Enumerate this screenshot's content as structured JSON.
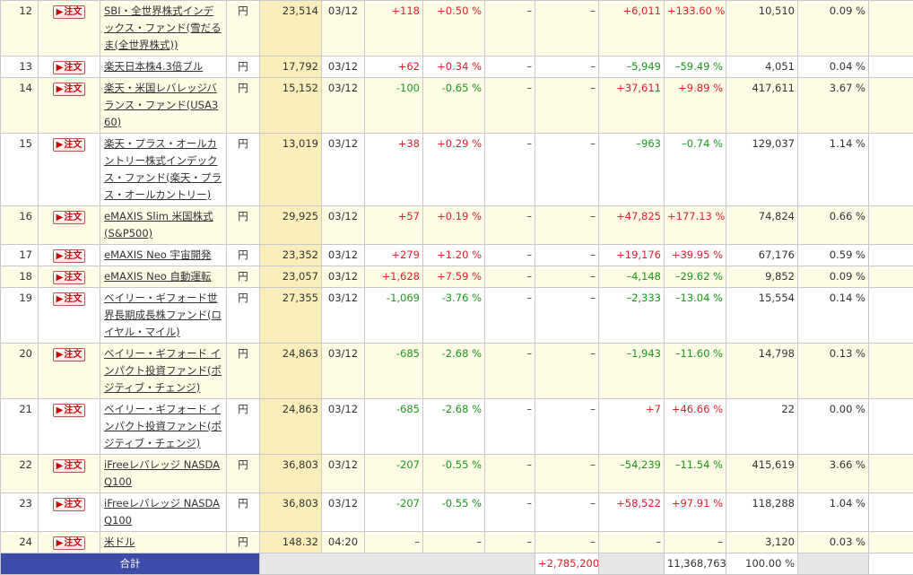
{
  "order_button_label": "注文",
  "rows": [
    {
      "no": "12",
      "name": "SBI・全世界株式インデックス・ファンド(雪だるま(全世界株式))",
      "cur": "円",
      "price": "23,514",
      "date": "03/12",
      "chg": "+118",
      "chgp": "+0.50 %",
      "a": "–",
      "b": "–",
      "pl": "+6,011",
      "plp": "+133.60 %",
      "val": "10,510",
      "pct": "0.09 %",
      "z": "–",
      "bg": "y",
      "h": 60
    },
    {
      "no": "13",
      "name": "楽天日本株4.3倍ブル",
      "cur": "円",
      "price": "17,792",
      "date": "03/12",
      "chg": "+62",
      "chgp": "+0.34 %",
      "a": "–",
      "b": "–",
      "pl": "–5,949",
      "plp": "–59.49 %",
      "val": "4,051",
      "pct": "0.04 %",
      "z": "–",
      "bg": "w",
      "h": 22
    },
    {
      "no": "14",
      "name": "楽天・米国レバレッジバランス・ファンド(USA360)",
      "cur": "円",
      "price": "15,152",
      "date": "03/12",
      "chg": "-100",
      "chgp": "-0.65 %",
      "a": "–",
      "b": "–",
      "pl": "+37,611",
      "plp": "+9.89 %",
      "val": "417,611",
      "pct": "3.67 %",
      "z": "–",
      "bg": "y",
      "h": 60
    },
    {
      "no": "15",
      "name": "楽天・プラス・オールカントリー株式インデックス・ファンド(楽天・プラス・オールカントリー)",
      "cur": "円",
      "price": "13,019",
      "date": "03/12",
      "chg": "+38",
      "chgp": "+0.29 %",
      "a": "–",
      "b": "–",
      "pl": "–963",
      "plp": "–0.74 %",
      "val": "129,037",
      "pct": "1.14 %",
      "z": "–",
      "bg": "w",
      "h": 80
    },
    {
      "no": "16",
      "name": "eMAXIS Slim 米国株式(S&P500)",
      "cur": "円",
      "price": "29,925",
      "date": "03/12",
      "chg": "+57",
      "chgp": "+0.19 %",
      "a": "–",
      "b": "–",
      "pl": "+47,825",
      "plp": "+177.13 %",
      "val": "74,824",
      "pct": "0.66 %",
      "z": "–",
      "bg": "y",
      "h": 40
    },
    {
      "no": "17",
      "name": "eMAXIS Neo 宇宙開発",
      "cur": "円",
      "price": "23,352",
      "date": "03/12",
      "chg": "+279",
      "chgp": "+1.20 %",
      "a": "–",
      "b": "–",
      "pl": "+19,176",
      "plp": "+39.95 %",
      "val": "67,176",
      "pct": "0.59 %",
      "z": "–",
      "bg": "w",
      "h": 22
    },
    {
      "no": "18",
      "name": "eMAXIS Neo 自動運転",
      "cur": "円",
      "price": "23,057",
      "date": "03/12",
      "chg": "+1,628",
      "chgp": "+7.59 %",
      "a": "–",
      "b": "–",
      "pl": "–4,148",
      "plp": "–29.62 %",
      "val": "9,852",
      "pct": "0.09 %",
      "z": "–",
      "bg": "y",
      "h": 22
    },
    {
      "no": "19",
      "name": "ベイリー・ギフォード世界長期成長株ファンド(ロイヤル・マイル)",
      "cur": "円",
      "price": "27,355",
      "date": "03/12",
      "chg": "-1,069",
      "chgp": "-3.76 %",
      "a": "–",
      "b": "–",
      "pl": "–2,333",
      "plp": "–13.04 %",
      "val": "15,554",
      "pct": "0.14 %",
      "z": "–",
      "bg": "w",
      "h": 60
    },
    {
      "no": "20",
      "name": "ベイリー・ギフォード インパクト投資ファンド(ポジティブ・チェンジ)",
      "cur": "円",
      "price": "24,863",
      "date": "03/12",
      "chg": "-685",
      "chgp": "-2.68 %",
      "a": "–",
      "b": "–",
      "pl": "–1,943",
      "plp": "–11.60 %",
      "val": "14,798",
      "pct": "0.13 %",
      "z": "–",
      "bg": "y",
      "h": 60
    },
    {
      "no": "21",
      "name": "ベイリー・ギフォード インパクト投資ファンド(ポジティブ・チェンジ)",
      "cur": "円",
      "price": "24,863",
      "date": "03/12",
      "chg": "-685",
      "chgp": "-2.68 %",
      "a": "–",
      "b": "–",
      "pl": "+7",
      "plp": "+46.66 %",
      "val": "22",
      "pct": "0.00 %",
      "z": "–",
      "bg": "w",
      "h": 60
    },
    {
      "no": "22",
      "name": "iFreeレバレッジ NASDAQ100",
      "cur": "円",
      "price": "36,803",
      "date": "03/12",
      "chg": "-207",
      "chgp": "-0.55 %",
      "a": "–",
      "b": "–",
      "pl": "–54,239",
      "plp": "–11.54 %",
      "val": "415,619",
      "pct": "3.66 %",
      "z": "–",
      "bg": "y",
      "h": 40
    },
    {
      "no": "23",
      "name": "iFreeレバレッジ NASDAQ100",
      "cur": "円",
      "price": "36,803",
      "date": "03/12",
      "chg": "-207",
      "chgp": "-0.55 %",
      "a": "–",
      "b": "–",
      "pl": "+58,522",
      "plp": "+97.91 %",
      "val": "118,288",
      "pct": "1.04 %",
      "z": "–",
      "bg": "w",
      "h": 40
    },
    {
      "no": "24",
      "name": "米ドル",
      "cur": "円",
      "price": "148.32",
      "date": "04:20",
      "chg": "–",
      "chgp": "–",
      "a": "–",
      "b": "–",
      "pl": "–",
      "plp": "–",
      "val": "3,120",
      "pct": "0.03 %",
      "z": "–",
      "bg": "y",
      "h": 22
    }
  ],
  "total": {
    "label": "合計",
    "pl": "+2,785,200",
    "val": "11,368,763",
    "pct": "100.00 %",
    "z": "–"
  },
  "colors": {
    "plus": "#e0202e",
    "minus": "#1a9a1a",
    "total_label_bg": "#3f4bab",
    "row_alt_bg": "#fffce6"
  }
}
